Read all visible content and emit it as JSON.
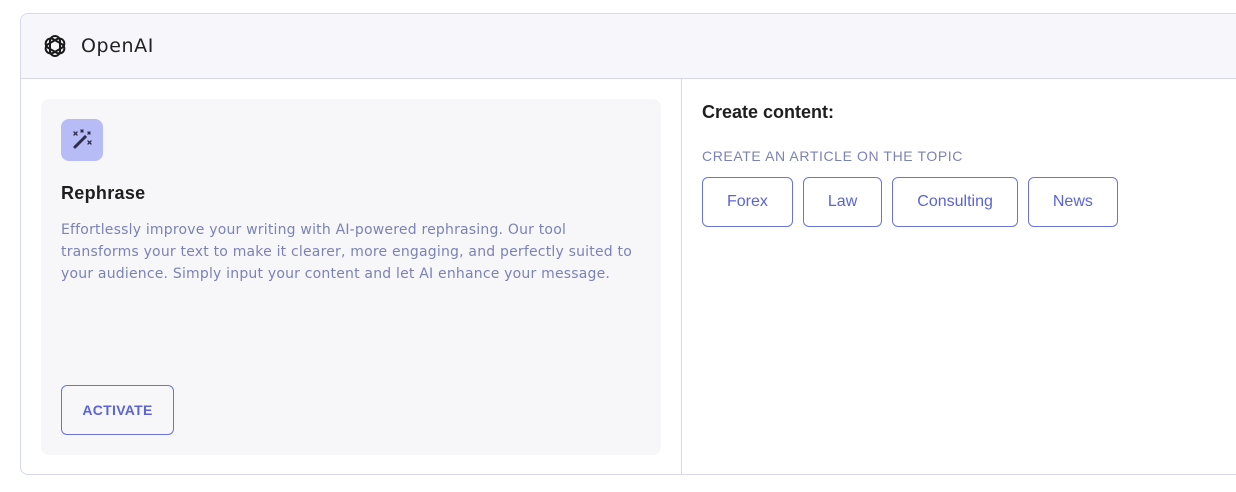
{
  "header": {
    "title": "OpenAI",
    "logo_icon": "openai-logo-icon"
  },
  "card": {
    "icon": "magic-wand-icon",
    "title": "Rephrase",
    "description": "Effortlessly improve your writing with AI-powered rephrasing. Our tool transforms your text to make it clearer, more engaging, and perfectly suited to your audience. Simply input your content and let AI enhance your message.",
    "button_label": "ACTIVATE"
  },
  "create": {
    "title": "Create content:",
    "subtitle": "CREATE AN ARTICLE ON THE TOPIC",
    "topics": [
      "Forex",
      "Law",
      "Consulting",
      "News"
    ]
  },
  "colors": {
    "accent": "#5a64d4",
    "border": "#d6d9ee",
    "icon_bg": "#b7bcf6",
    "muted_text": "#7b83b5"
  }
}
